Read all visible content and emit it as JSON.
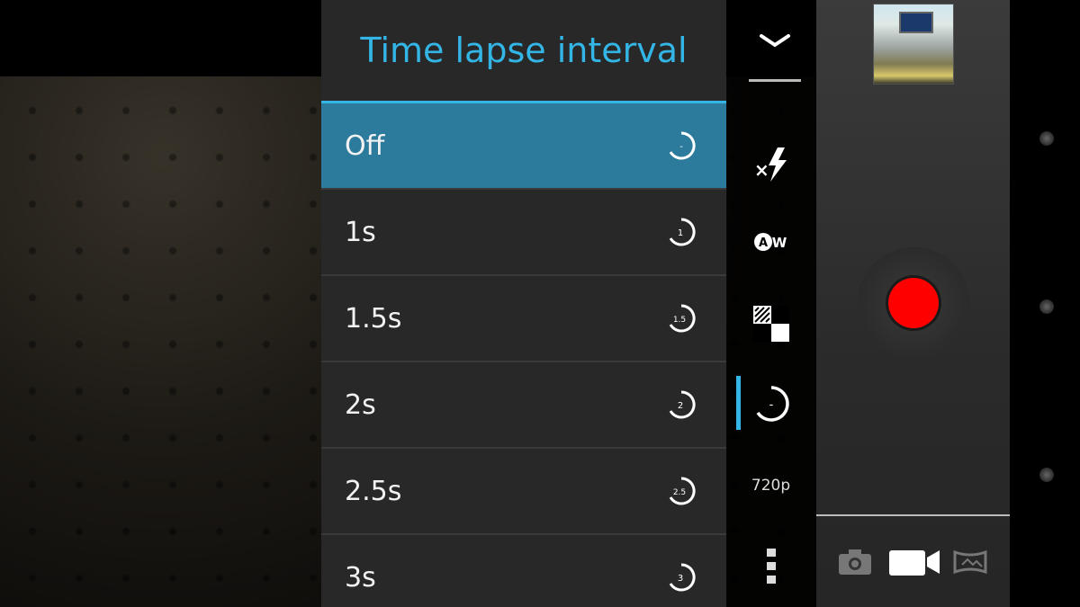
{
  "dialog": {
    "title": "Time lapse interval",
    "options": [
      {
        "label": "Off",
        "badge": "-",
        "selected": true
      },
      {
        "label": "1s",
        "badge": "1"
      },
      {
        "label": "1.5s",
        "badge": "1.5"
      },
      {
        "label": "2s",
        "badge": "2"
      },
      {
        "label": "2.5s",
        "badge": "2.5"
      },
      {
        "label": "3s",
        "badge": "3"
      }
    ]
  },
  "settings_strip": {
    "collapse_icon": "chevron-down-icon",
    "items": [
      {
        "name": "flash-off-icon"
      },
      {
        "name": "auto-white-balance-icon",
        "text": "W"
      },
      {
        "name": "scene-mode-icon"
      },
      {
        "name": "time-lapse-icon",
        "badge": "-",
        "active": true
      },
      {
        "name": "video-quality",
        "text": "720p"
      },
      {
        "name": "more-options-icon"
      }
    ]
  },
  "controls": {
    "thumbnail": "last-capture-thumbnail",
    "record": "record-button",
    "modes": [
      "photo-mode-icon",
      "video-mode-icon",
      "panorama-mode-icon"
    ]
  },
  "colors": {
    "accent": "#33b5e5",
    "selected_row": "#2d7b9c",
    "dialog_bg": "#282828",
    "record": "#ff0000"
  }
}
